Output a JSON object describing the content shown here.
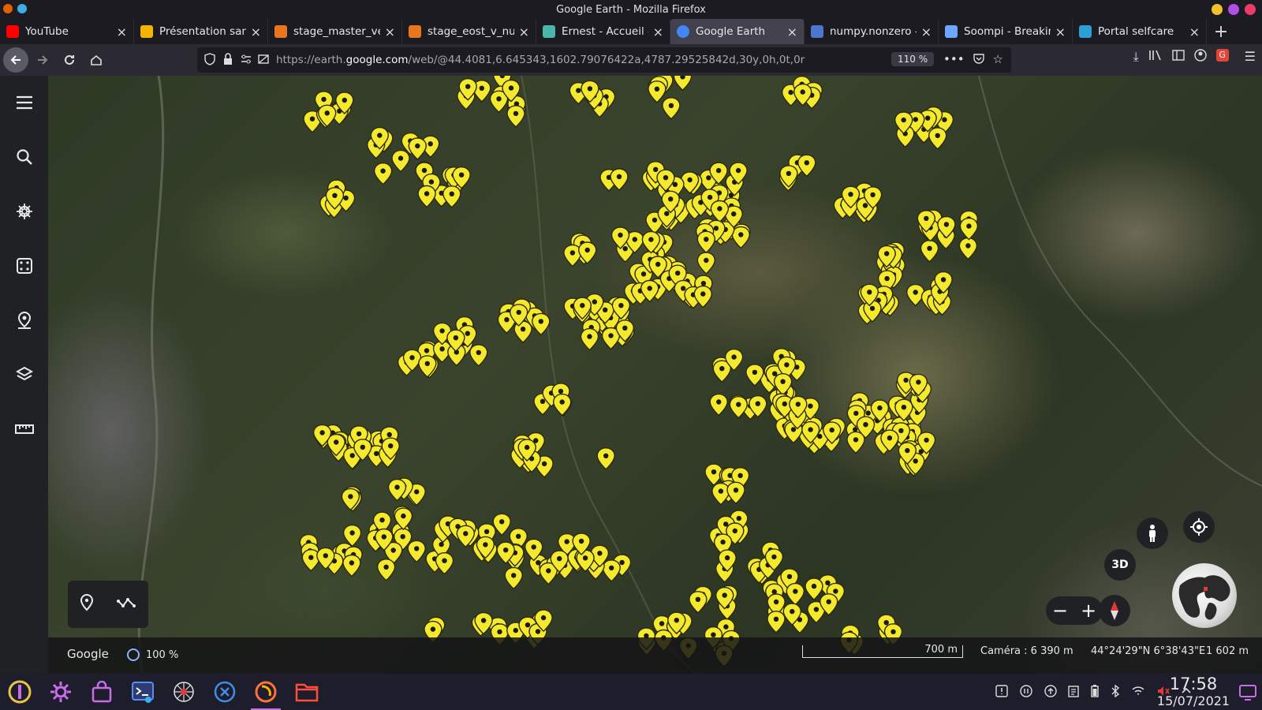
{
  "window": {
    "title": "Google Earth - Mozilla Firefox"
  },
  "tabs": [
    {
      "label": "YouTube",
      "favicon": "youtube-icon",
      "color": "#ff0000",
      "active": false
    },
    {
      "label": "Présentation sans",
      "favicon": "slides-icon",
      "color": "#f4b400",
      "active": false
    },
    {
      "label": "stage_master_vers",
      "favicon": "overleaf-doc-icon",
      "color": "#e8761e",
      "active": false
    },
    {
      "label": "stage_eost_v_num",
      "favicon": "overleaf-doc-icon",
      "color": "#e8761e",
      "active": false
    },
    {
      "label": "Ernest - Accueil - E",
      "favicon": "ernest-icon",
      "color": "#4cb5ab",
      "active": false
    },
    {
      "label": "Google Earth",
      "favicon": "earth-icon",
      "color": "#4285f4",
      "active": true
    },
    {
      "label": "numpy.nonzero —",
      "favicon": "numpy-icon",
      "color": "#4d77cf",
      "active": false
    },
    {
      "label": "Soompi - Breaking",
      "favicon": "star-icon",
      "color": "#6ea8fe",
      "active": false
    },
    {
      "label": "Portal selfcare",
      "favicon": "portal-icon",
      "color": "#2b9fd6",
      "active": false
    }
  ],
  "navbar": {
    "url_host": "https://earth.",
    "url_domain": "google.com",
    "url_path": "/web/@44.4081,6.645343,1602.79076422a,4787.29525842d,30y,0h,0t,0r",
    "zoom": "110 %"
  },
  "earth": {
    "sidebar_items": [
      "menu-icon",
      "search-icon",
      "voyager-icon",
      "feeling-lucky-icon",
      "projects-icon",
      "map-style-icon",
      "measure-icon"
    ],
    "brand": "Google",
    "loading": "100 %",
    "scale": "700 m",
    "camera": "Caméra : 6 390 m",
    "coordinates": "44°24'29\"N 6°38'43\"E",
    "altitude": "1 602 m",
    "mode_3d": "3D"
  },
  "taskbar": {
    "time": "17:58",
    "date": "15/07/2021",
    "apps": [
      "launcher-icon",
      "settings-icon",
      "store-icon",
      "terminal-icon",
      "spider-icon",
      "vscode-icon",
      "firefox-icon",
      "files-icon"
    ]
  }
}
